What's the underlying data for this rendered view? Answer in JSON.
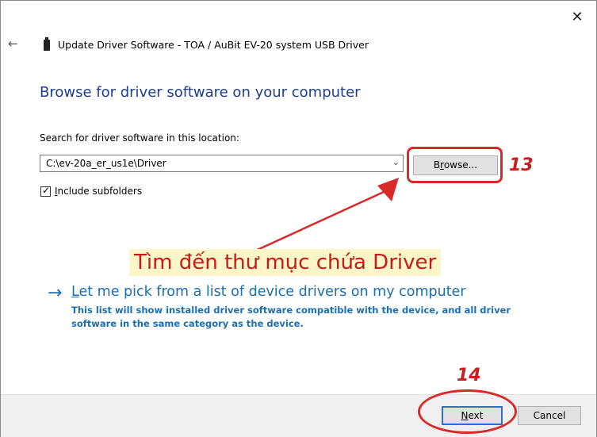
{
  "window": {
    "close_glyph": "✕",
    "back_glyph": "←",
    "title": "Update Driver Software - TOA / AuBit EV-20 system USB Driver"
  },
  "main": {
    "heading": "Browse for driver software on your computer",
    "search_label": "Search for driver software in this location:",
    "path_value": "C:\\ev-20a_er_us1e\\Driver",
    "browse_label_pre": "B",
    "browse_label_accel": "r",
    "browse_label_post": "owse...",
    "include_subfolders_accel": "I",
    "include_subfolders_rest": "nclude subfolders",
    "include_subfolders_checked": true
  },
  "link": {
    "arrow_glyph": "→",
    "title_accel": "L",
    "title_rest": "et me pick from a list of device drivers on my computer",
    "description": "This list will show installed driver software compatible with the device, and all driver software in the same category as the device."
  },
  "annotations": {
    "step_13": "13",
    "step_14": "14",
    "instruction": "Tìm đến thư mục chứa Driver",
    "color": "#d92a2a"
  },
  "footer": {
    "next_accel": "N",
    "next_rest": "ext",
    "cancel_label": "Cancel"
  }
}
